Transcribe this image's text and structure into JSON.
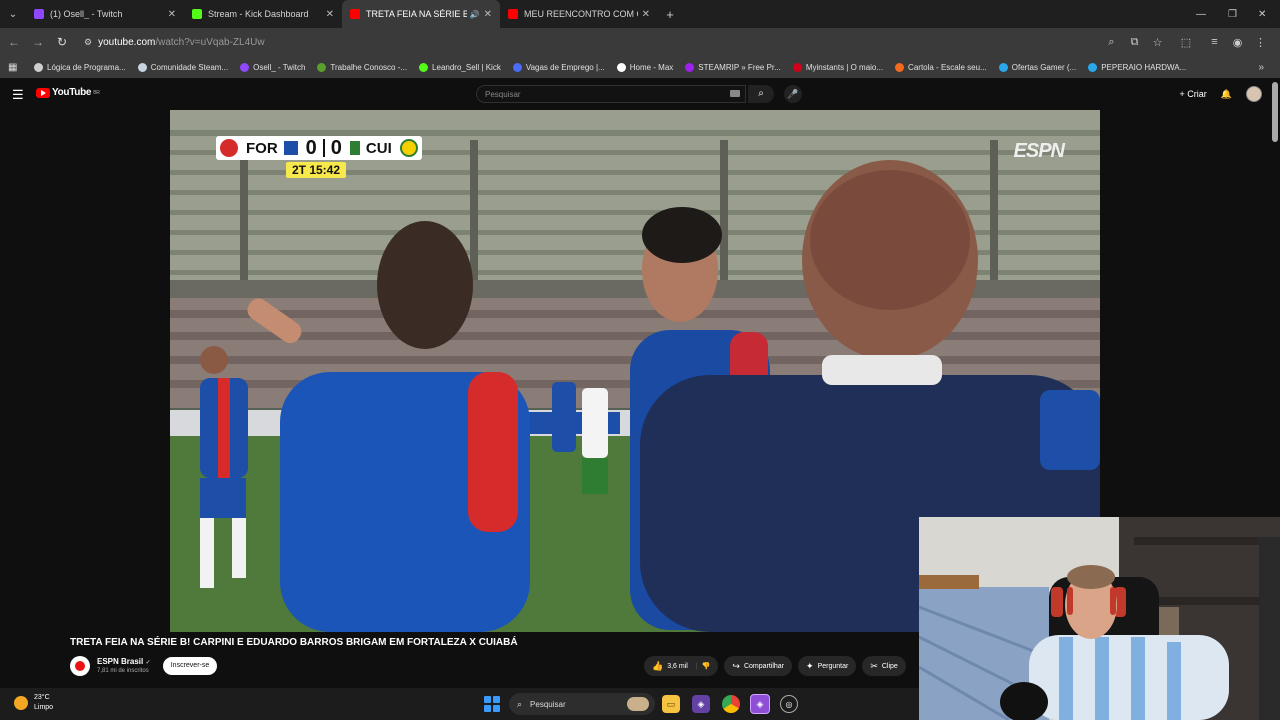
{
  "browser": {
    "tabs": [
      {
        "title": "(1) Osell_ - Twitch",
        "color": "#9146ff",
        "active": false
      },
      {
        "title": "Stream - Kick Dashboard",
        "color": "#53fc18",
        "active": false
      },
      {
        "title": "TRETA FEIA NA SÉRIE B! CA",
        "color": "#ff0000",
        "active": true
      },
      {
        "title": "MEU REENCONTRO COM COC",
        "color": "#ff0000",
        "active": false
      }
    ],
    "url_host": "youtube.com",
    "url_path": "/watch?v=uVqab-ZL4Uw",
    "bookmarks": [
      {
        "label": "Lógica de Programa...",
        "color": "#cfcfcf"
      },
      {
        "label": "Comunidade Steam...",
        "color": "#c7d5e0"
      },
      {
        "label": "Osell_ - Twitch",
        "color": "#9146ff"
      },
      {
        "label": "Trabalhe Conosco -...",
        "color": "#5aa02c"
      },
      {
        "label": "Leandro_Sell | Kick",
        "color": "#53fc18"
      },
      {
        "label": "Vagas de Emprego |...",
        "color": "#4a6cf7"
      },
      {
        "label": "Home - Max",
        "color": "#ffffff"
      },
      {
        "label": "STEAMRIP » Free Pr...",
        "color": "#a020f0"
      },
      {
        "label": "Myinstants | O maio...",
        "color": "#d0021b"
      },
      {
        "label": "Cartola - Escale seu...",
        "color": "#f56a1c"
      },
      {
        "label": "Ofertas Gamer (...",
        "color": "#29a9eb"
      },
      {
        "label": "PEPERAIO HARDWA...",
        "color": "#29a9eb"
      }
    ]
  },
  "youtube": {
    "logo_text": "YouTube",
    "logo_region": "BR",
    "search_placeholder": "Pesquisar",
    "create_label": "Criar"
  },
  "video": {
    "scoreboard": {
      "home": "FOR",
      "home_score": "0",
      "away_score": "0",
      "away": "CUI",
      "clock": "2T  15:42"
    },
    "broadcaster": "ESPN",
    "title": "TRETA FEIA NA SÉRIE B! CARPINI E EDUARDO BARROS BRIGAM EM FORTALEZA X CUIABÁ",
    "channel": "ESPN Brasil",
    "subscribers": "7,81 mi de inscritos",
    "subscribe_label": "Inscrever-se",
    "likes": "3,6 mil",
    "share_label": "Compartilhar",
    "ask_label": "Perguntar",
    "clip_label": "Clipe"
  },
  "taskbar": {
    "temperature": "23°C",
    "condition": "Limpo",
    "search_label": "Pesquisar"
  },
  "colors": {
    "accent_red": "#ff0000",
    "fortaleza_blue": "#1d4fa8",
    "fortaleza_red": "#d62b2b",
    "pitch": "#4f7a3c"
  }
}
